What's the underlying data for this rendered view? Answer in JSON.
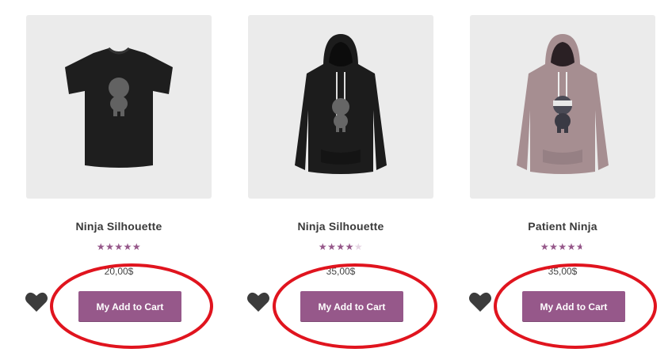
{
  "products": [
    {
      "title": "Ninja Silhouette",
      "price": "20,00$",
      "rating": 5.0,
      "button_label": "My Add to Cart",
      "image": "black-tshirt-ninja-silhouette",
      "heart_icon": "heart-icon"
    },
    {
      "title": "Ninja Silhouette",
      "price": "35,00$",
      "rating": 4.0,
      "button_label": "My Add to Cart",
      "image": "black-hoodie-ninja-silhouette",
      "heart_icon": "heart-icon"
    },
    {
      "title": "Patient Ninja",
      "price": "35,00$",
      "rating": 4.67,
      "button_label": "My Add to Cart",
      "image": "mauve-hoodie-patient-ninja",
      "heart_icon": "heart-icon"
    }
  ],
  "stars_glyph": "★★★★★",
  "colors": {
    "accent": "#96588a",
    "annotation": "#e0141e",
    "heart": "#3c3c3c",
    "thumb_bg": "#ebebeb"
  }
}
